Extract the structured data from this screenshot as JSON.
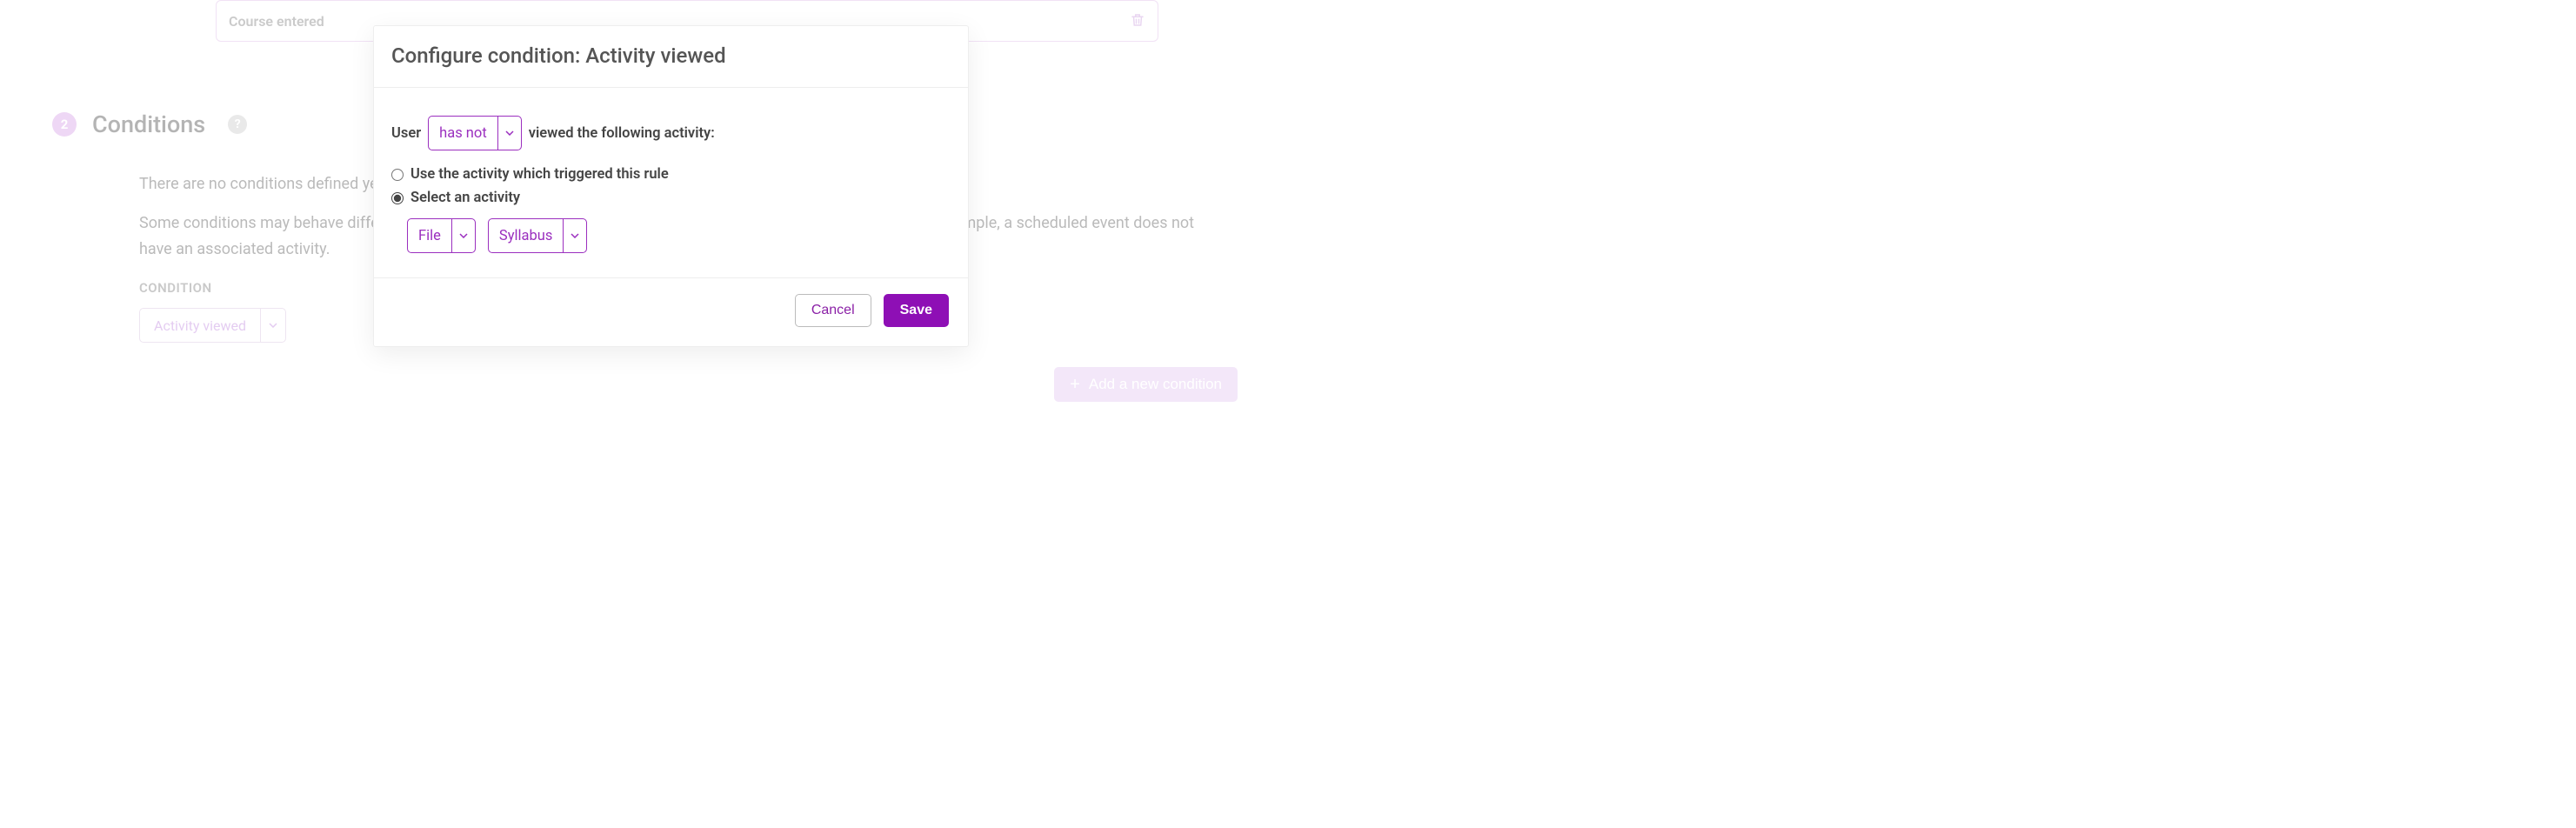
{
  "background": {
    "course_entered_label": "Course entered",
    "step_number": "2",
    "step_title": "Conditions",
    "help_symbol": "?",
    "description_line1": "There are no conditions defined yet. A rule without conditions will always execute its actions when an event occurs.",
    "description_line2": "Some conditions may behave different, or be irrelevant, depending on the type of user, system or course action. For example, a scheduled event does not have an associated activity.",
    "condition_label": "CONDITION",
    "activity_select_value": "Activity viewed",
    "add_condition_label": "Add a new condition",
    "plus_symbol": "+"
  },
  "modal": {
    "title": "Configure condition: Activity viewed",
    "sentence_prefix": "User",
    "has_not_value": "has not",
    "sentence_suffix": "viewed the following activity:",
    "radio_trigger_label": "Use the activity which triggered this rule",
    "radio_select_label": "Select an activity",
    "radio_selected": "select",
    "type_select_value": "File",
    "activity_select_value": "Syllabus",
    "cancel_label": "Cancel",
    "save_label": "Save"
  }
}
